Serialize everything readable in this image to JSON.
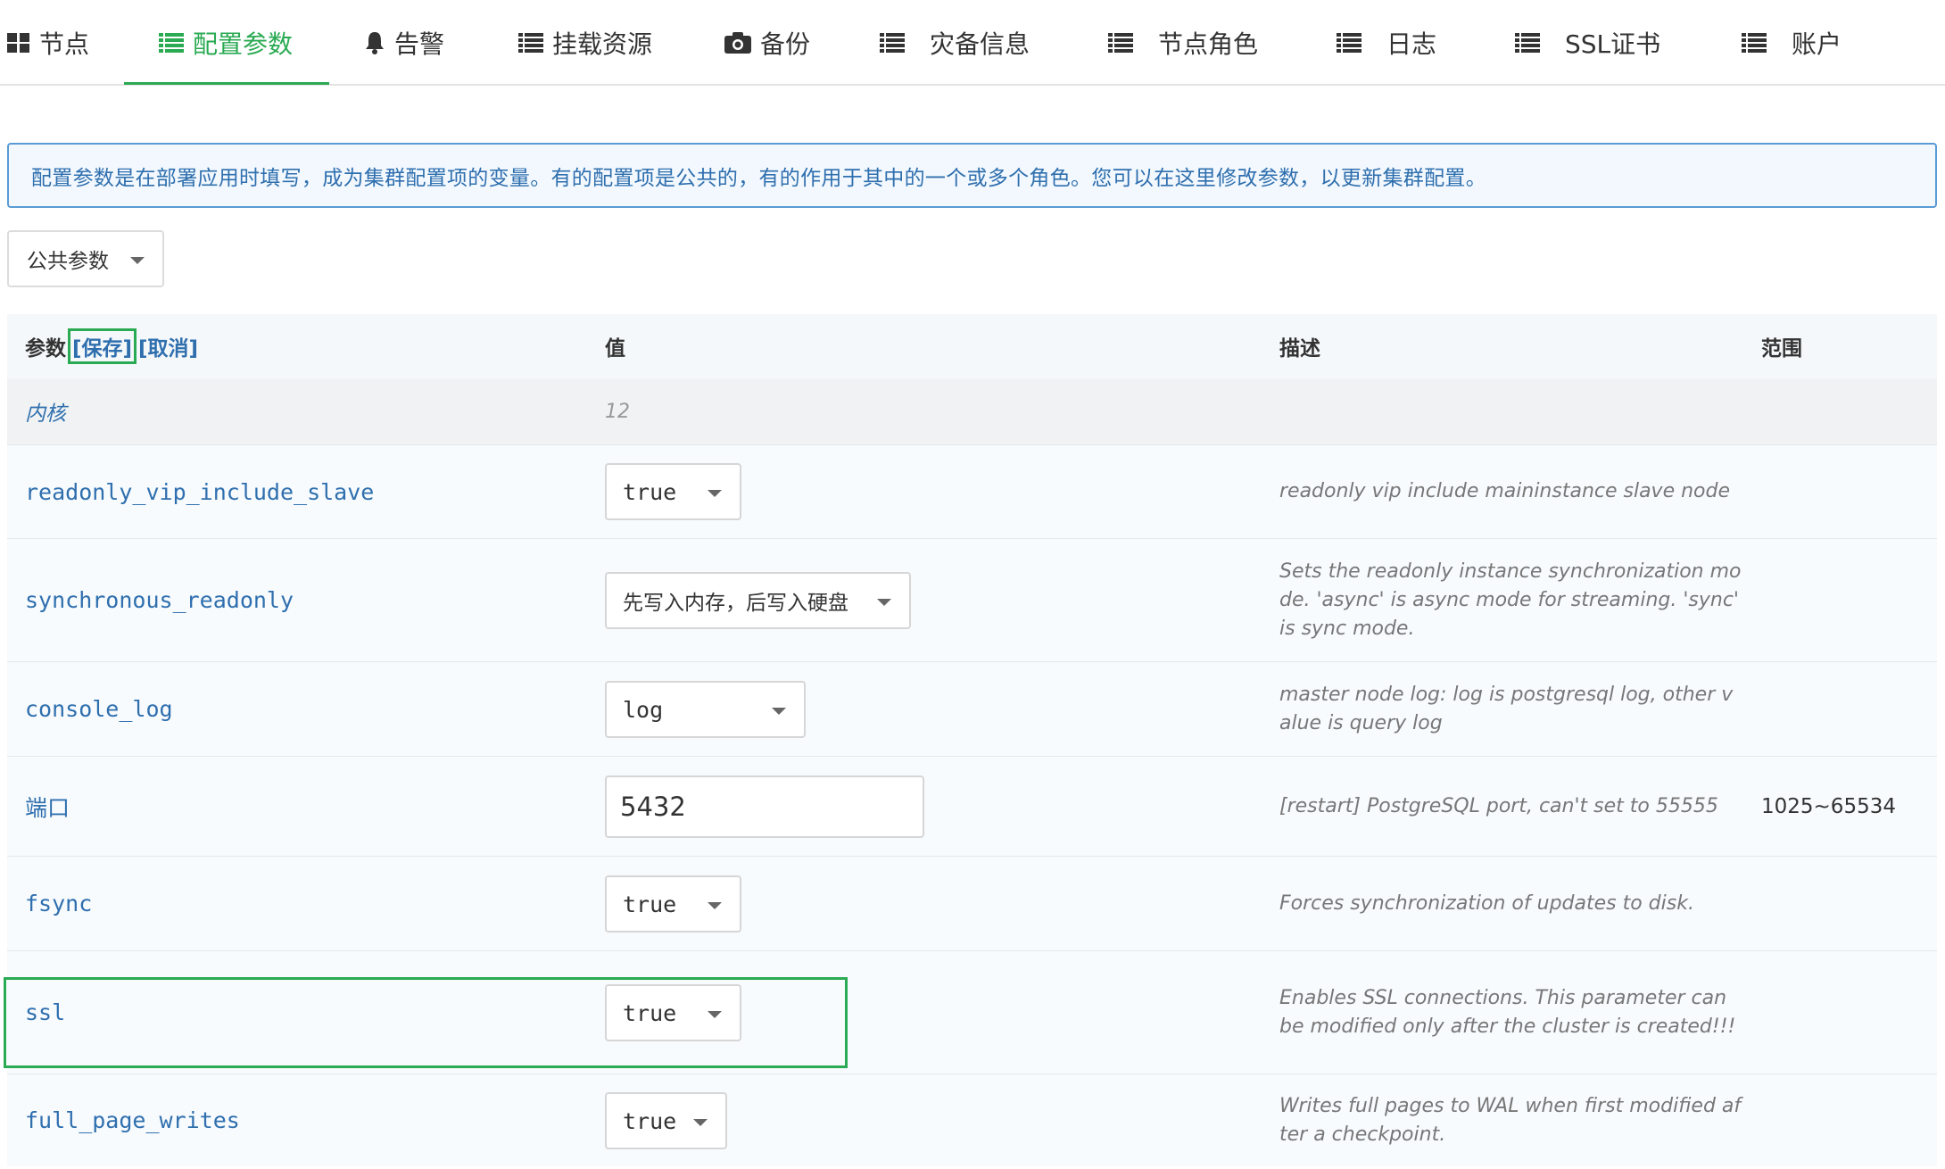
{
  "tabs": [
    {
      "label": "节点",
      "icon": "grid-icon"
    },
    {
      "label": "配置参数",
      "icon": "list-icon",
      "active": true
    },
    {
      "label": "告警",
      "icon": "bell-icon"
    },
    {
      "label": "挂载资源",
      "icon": "list-icon"
    },
    {
      "label": "备份",
      "icon": "camera-icon"
    },
    {
      "label": "灾备信息",
      "icon": "list-icon"
    },
    {
      "label": "节点角色",
      "icon": "list-icon"
    },
    {
      "label": "日志",
      "icon": "list-icon"
    },
    {
      "label": "SSL证书",
      "icon": "list-icon"
    },
    {
      "label": "账户",
      "icon": "list-icon"
    }
  ],
  "info_text": "配置参数是在部署应用时填写，成为集群配置项的变量。有的配置项是公共的，有的作用于其中的一个或多个角色。您可以在这里修改参数，以更新集群配置。",
  "scope_select": {
    "value": "公共参数"
  },
  "table": {
    "headers": {
      "param": "参数",
      "save": "[保存]",
      "cancel": "[取消]",
      "value": "值",
      "description": "描述",
      "range": "范围"
    },
    "group": {
      "name": "内核",
      "value": "12"
    },
    "rows": [
      {
        "name": "readonly_vip_include_slave",
        "type": "select",
        "value": "true",
        "description": "readonly vip include maininstance slave node",
        "range": ""
      },
      {
        "name": "synchronous_readonly",
        "type": "select",
        "value": "先写入内存，后写入硬盘",
        "description": "Sets the readonly instance synchronization mode. 'async' is async mode for streaming. 'sync' is sync mode.",
        "range": ""
      },
      {
        "name": "console_log",
        "type": "select",
        "value": "log",
        "description": "master node log: log is postgresql log, other value is query log",
        "range": ""
      },
      {
        "name": "端口",
        "type": "text",
        "value": "5432",
        "description": "[restart] PostgreSQL port, can't set to 55555",
        "range": "1025~65534"
      },
      {
        "name": "fsync",
        "type": "select",
        "value": "true",
        "description": "Forces synchronization of updates to disk.",
        "range": ""
      },
      {
        "name": "ssl",
        "type": "select",
        "value": "true",
        "description": "Enables SSL connections. This parameter can be modified only after the cluster is created!!!",
        "range": ""
      },
      {
        "name": "full_page_writes",
        "type": "select",
        "value": "true",
        "description": "Writes full pages to WAL when first modified after a checkpoint.",
        "range": ""
      }
    ]
  },
  "colors": {
    "accent": "#2aaa52",
    "link": "#2f6fae",
    "info_border": "#5b9bd5"
  }
}
